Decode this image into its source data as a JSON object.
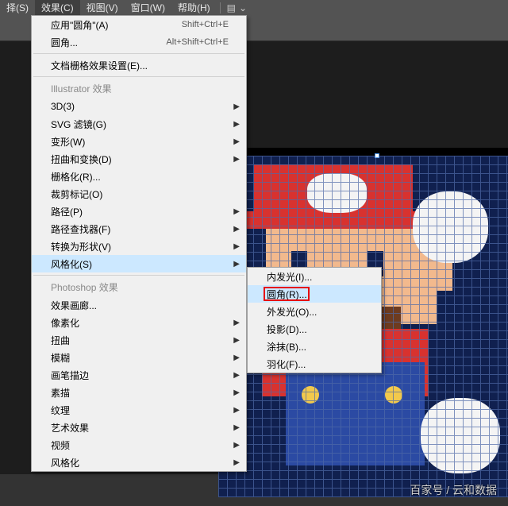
{
  "menubar": {
    "items": [
      "择(S)",
      "效果(C)",
      "视图(V)",
      "窗口(W)",
      "帮助(H)"
    ],
    "active_index": 1,
    "extra_icon": "▤",
    "extra_chevron": "⌄"
  },
  "dropdown": {
    "apply_last": {
      "label": "应用\"圆角\"(A)",
      "accel": "Shift+Ctrl+E"
    },
    "last_effect": {
      "label": "圆角...",
      "accel": "Alt+Shift+Ctrl+E"
    },
    "doc_raster": {
      "label": "文档栅格效果设置(E)..."
    },
    "section_ai": "Illustrator 效果",
    "ai_items": [
      {
        "label": "3D(3)",
        "sub": true
      },
      {
        "label": "SVG 滤镜(G)",
        "sub": true
      },
      {
        "label": "变形(W)",
        "sub": true
      },
      {
        "label": "扭曲和变换(D)",
        "sub": true
      },
      {
        "label": "栅格化(R)..."
      },
      {
        "label": "裁剪标记(O)"
      },
      {
        "label": "路径(P)",
        "sub": true
      },
      {
        "label": "路径查找器(F)",
        "sub": true
      },
      {
        "label": "转换为形状(V)",
        "sub": true
      },
      {
        "label": "风格化(S)",
        "sub": true,
        "highlight": true
      }
    ],
    "section_ps": "Photoshop 效果",
    "ps_items": [
      {
        "label": "效果画廊..."
      },
      {
        "label": "像素化",
        "sub": true
      },
      {
        "label": "扭曲",
        "sub": true
      },
      {
        "label": "模糊",
        "sub": true
      },
      {
        "label": "画笔描边",
        "sub": true
      },
      {
        "label": "素描",
        "sub": true
      },
      {
        "label": "纹理",
        "sub": true
      },
      {
        "label": "艺术效果",
        "sub": true
      },
      {
        "label": "视频",
        "sub": true
      },
      {
        "label": "风格化",
        "sub": true
      }
    ]
  },
  "submenu": {
    "items": [
      {
        "label": "内发光(I)..."
      },
      {
        "label": "圆角(R)...",
        "selected": true,
        "redbox": true
      },
      {
        "label": "外发光(O)..."
      },
      {
        "label": "投影(D)..."
      },
      {
        "label": "涂抹(B)..."
      },
      {
        "label": "羽化(F)..."
      }
    ]
  },
  "watermark": "百家号 / 云和数据",
  "art": {
    "hat": "#d8322f",
    "skin": "#f2b98d",
    "white": "#f4f4f4",
    "blue": "#2b4aa3",
    "navy": "#10204f",
    "brown": "#6d3b1f",
    "yellow": "#f2c94c"
  }
}
